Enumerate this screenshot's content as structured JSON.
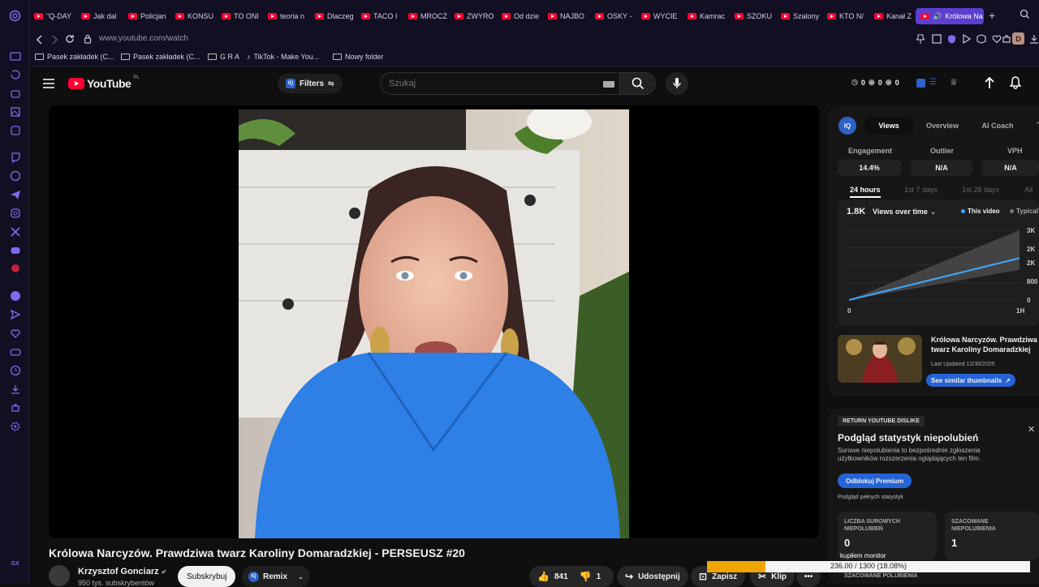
{
  "browser": {
    "tabs": [
      {
        "label": "\"Q-DAY"
      },
      {
        "label": "Jak dal"
      },
      {
        "label": "Policjan"
      },
      {
        "label": "KONSU"
      },
      {
        "label": "TO ONI"
      },
      {
        "label": "teoria n"
      },
      {
        "label": "Dlaczeg"
      },
      {
        "label": "TACO I"
      },
      {
        "label": "MROCZ"
      },
      {
        "label": "ZWYRO"
      },
      {
        "label": "Od dzie"
      },
      {
        "label": "NAJBO"
      },
      {
        "label": "OSKY -"
      },
      {
        "label": "WYCIE"
      },
      {
        "label": "Kamrac"
      },
      {
        "label": "SZOKU"
      },
      {
        "label": "Szalony"
      },
      {
        "label": "KTO N/"
      },
      {
        "label": "Kanał Z"
      }
    ],
    "active_tab": {
      "label": "Królowa Na"
    },
    "url": "www.youtube.com/watch",
    "profile_initial": "D",
    "bookmarks": [
      {
        "label": "Pasek zakładek (C...",
        "icon": "folder-icon"
      },
      {
        "label": "Pasek zakładek (C...",
        "icon": "folder-icon"
      },
      {
        "label": "G R A",
        "icon": "folder-icon"
      },
      {
        "label": "TikTok - Make You...",
        "icon": "tiktok-icon"
      },
      {
        "label": "Nowy folder",
        "icon": "folder-icon"
      }
    ]
  },
  "youtube": {
    "logo_text": "YouTube",
    "country_code": "PL",
    "filters_label": "Filters",
    "search_placeholder": "Szukaj",
    "header_stats": {
      "a": "0",
      "b": "0",
      "c": "0"
    },
    "video_title": "Królowa Narcyzów. Prawdziwa twarz Karoliny Domaradzkiej - PERSEUSZ #20",
    "channel_name": "Krzysztof Gonciarz",
    "subscribers": "950 tys. subskrybentów",
    "subscribe_label": "Subskrybuj",
    "remix_label": "Remix",
    "likes": "841",
    "dislikes": "1",
    "share_label": "Udostępnij",
    "save_label": "Zapisz",
    "clip_label": "Klip"
  },
  "vidiq": {
    "tabs": [
      "Views",
      "Overview",
      "AI Coach"
    ],
    "metrics": [
      {
        "label": "Engagement",
        "value": "14.4%"
      },
      {
        "label": "Outlier",
        "value": "N/A"
      },
      {
        "label": "VPH",
        "value": "N/A"
      }
    ],
    "time_tabs": [
      "24 hours",
      "1st 7 days",
      "1st 28 days",
      "All"
    ],
    "views_value": "1.8K",
    "views_dropdown": "Views over time",
    "legend_this": "This video",
    "legend_typical": "Typical",
    "thumbnail_title": "Królowa Narcyzów. Prawdziwa twarz Karoliny Domaradzkiej",
    "last_updated": "Last Updated 12/30/2025",
    "similar_btn": "See similar thumbnails"
  },
  "chart_data": {
    "type": "line",
    "x_ticks": [
      "0",
      "1H"
    ],
    "y_ticks": [
      "0",
      "800",
      "2K",
      "2K",
      "3K"
    ],
    "series": [
      {
        "name": "This video",
        "x": [
          0,
          1
        ],
        "y": [
          0,
          1800
        ]
      }
    ],
    "band": {
      "name": "Typical",
      "lower": [
        0,
        1300
      ],
      "upper": [
        0,
        3000
      ]
    },
    "ylim": [
      0,
      3000
    ]
  },
  "ryd": {
    "badge": "RETURN YOUTUBE DISLIKE",
    "title": "Podgląd statystyk niepolubień",
    "desc": "Surowe niepolubienia to bezpośrednie zgłoszenia użytkowników rozszerzenia oglądających ten film.",
    "unlock_btn": "Odblokuj Premium",
    "full_stats": "Podgląd pełnych statystyk",
    "raw_label": "LICZBA SUROWYCH NIEPOLUBIEŃ",
    "raw_value": "0",
    "est_label": "SZACOWANE NIEPOLUBIENIA",
    "est_value": "1",
    "est_likes_label": "SZACOWANE POLUBIENIA",
    "bought_text": "kupiłem monitor"
  },
  "progress": {
    "text": "236.00 / 1300 (18.08%)",
    "fraction": 0.1808
  }
}
